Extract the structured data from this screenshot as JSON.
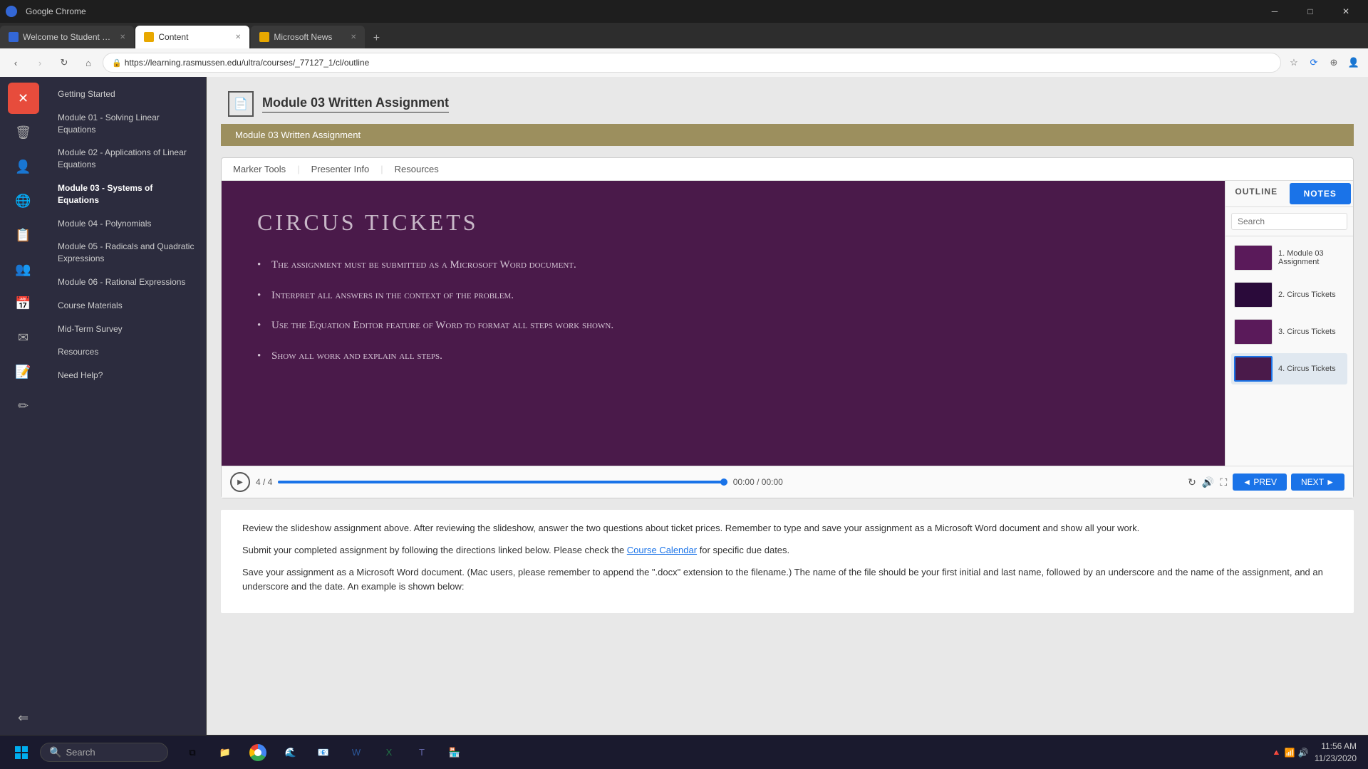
{
  "browser": {
    "tabs": [
      {
        "id": "tab1",
        "label": "Welcome to Student Portal",
        "active": false,
        "favicon_color": "#3367d6"
      },
      {
        "id": "tab2",
        "label": "Content",
        "active": true,
        "favicon_color": "#e8a800"
      },
      {
        "id": "tab3",
        "label": "Microsoft News",
        "active": false,
        "favicon_color": "#e8a800"
      }
    ],
    "address": "https://learning.rasmussen.edu/ultra/courses/_77127_1/cl/outline",
    "nav": {
      "back": "‹",
      "forward": "›",
      "refresh": "↻",
      "home": "⌂"
    }
  },
  "sidebar": {
    "icons": [
      {
        "id": "close-x",
        "symbol": "✕",
        "active": true
      },
      {
        "id": "trash",
        "symbol": "🗑"
      },
      {
        "id": "user",
        "symbol": "👤"
      },
      {
        "id": "globe",
        "symbol": "🌐"
      },
      {
        "id": "docs",
        "symbol": "📋"
      },
      {
        "id": "group",
        "symbol": "👥"
      },
      {
        "id": "calendar",
        "symbol": "📅"
      },
      {
        "id": "mail",
        "symbol": "✉"
      },
      {
        "id": "notes",
        "symbol": "📝"
      },
      {
        "id": "edit",
        "symbol": "✏"
      },
      {
        "id": "logout",
        "symbol": "⇐"
      }
    ]
  },
  "course_nav": {
    "items": [
      {
        "id": "getting-started",
        "label": "Getting Started"
      },
      {
        "id": "module01",
        "label": "Module 01 - Solving Linear Equations"
      },
      {
        "id": "module02",
        "label": "Module 02 - Applications of Linear Equations"
      },
      {
        "id": "module03",
        "label": "Module 03 - Systems of Equations",
        "active": true
      },
      {
        "id": "module04",
        "label": "Module 04 - Polynomials"
      },
      {
        "id": "module05",
        "label": "Module 05 - Radicals and Quadratic Expressions"
      },
      {
        "id": "module06",
        "label": "Module 06 - Rational Expressions"
      },
      {
        "id": "course-materials",
        "label": "Course Materials"
      },
      {
        "id": "midterm",
        "label": "Mid-Term Survey"
      },
      {
        "id": "resources",
        "label": "Resources"
      },
      {
        "id": "need-help",
        "label": "Need Help?"
      }
    ]
  },
  "content": {
    "page_title": "Module 03 Written Assignment",
    "subtitle_bar": "Module 03 Written Assignment",
    "presentation": {
      "toolbar_items": [
        "Marker Tools",
        "Presenter Info",
        "Resources"
      ],
      "slide": {
        "title": "CIRCUS TICKETS",
        "bullets": [
          "The assignment must be submitted as a Microsoft Word document.",
          "Interpret all answers in the context of the problem.",
          "Use the Equation Editor feature of Word to format all steps work shown.",
          "Show all work and explain all steps."
        ]
      },
      "notes_panel": {
        "outline_tab": "OUTLINE",
        "notes_tab": "NOTES",
        "search_placeholder": "Search",
        "thumbnails": [
          {
            "id": 1,
            "label": "1. Module 03 Assignment"
          },
          {
            "id": 2,
            "label": "2. Circus Tickets"
          },
          {
            "id": 3,
            "label": "3. Circus Tickets"
          },
          {
            "id": 4,
            "label": "4. Circus Tickets",
            "active": true
          }
        ]
      },
      "playback": {
        "slide_counter": "4 / 4",
        "time": "00:00 / 00:00",
        "prev_label": "◄ PREV",
        "next_label": "NEXT ►"
      }
    },
    "text_blocks": [
      "Review the slideshow assignment above. After reviewing the slideshow, answer the two questions about ticket prices. Remember to type and save your assignment as a Microsoft Word document and show all your work.",
      "Submit your completed assignment by following the directions linked below. Please check the Course Calendar for specific due dates.",
      "Save your assignment as a Microsoft Word document. (Mac users, please remember to append the \".docx\" extension to the filename.) The name of the file should be your first initial and last name, followed by an underscore and the name of the assignment, and an underscore and the date. An example is shown below:"
    ],
    "course_calendar_link": "Course Calendar"
  },
  "taskbar": {
    "search_label": "Search",
    "time": "11:56 AM",
    "date": "11/23/2020",
    "apps": [
      "🪟",
      "🔍",
      "📋",
      "📁",
      "🌐",
      "⚙",
      "📦",
      "✉",
      "📊",
      "📘",
      "👥"
    ]
  }
}
